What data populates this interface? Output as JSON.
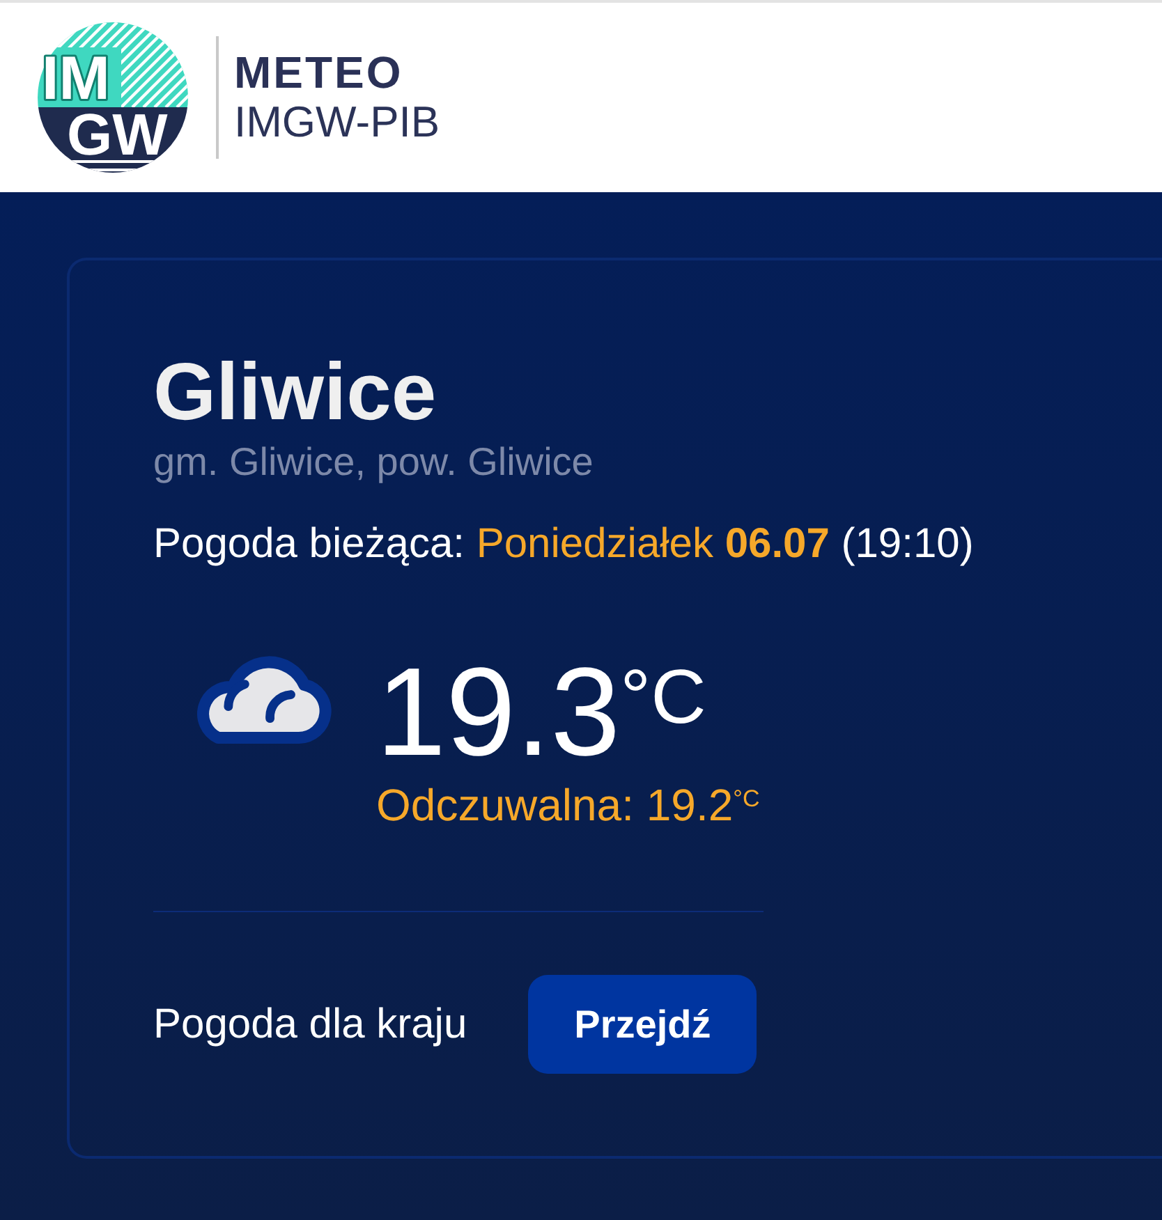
{
  "header": {
    "logo": {
      "top_letters": "IM",
      "bottom_letters": "GW"
    },
    "title": "METEO",
    "subtitle": "IMGW-PIB"
  },
  "location": {
    "name": "Gliwice",
    "region": "gm. Gliwice, pow. Gliwice"
  },
  "current": {
    "label": "Pogoda bieżąca:",
    "day": "Poniedziałek",
    "date": "06.07",
    "time": "(19:10)",
    "temperature": "19.3$^{°C}$",
    "feels_like": "Odczuwalna: 19.2$^{°C}$"
  },
  "country": {
    "label": "Pogoda dla kraju",
    "button": "Przejdź"
  }
}
